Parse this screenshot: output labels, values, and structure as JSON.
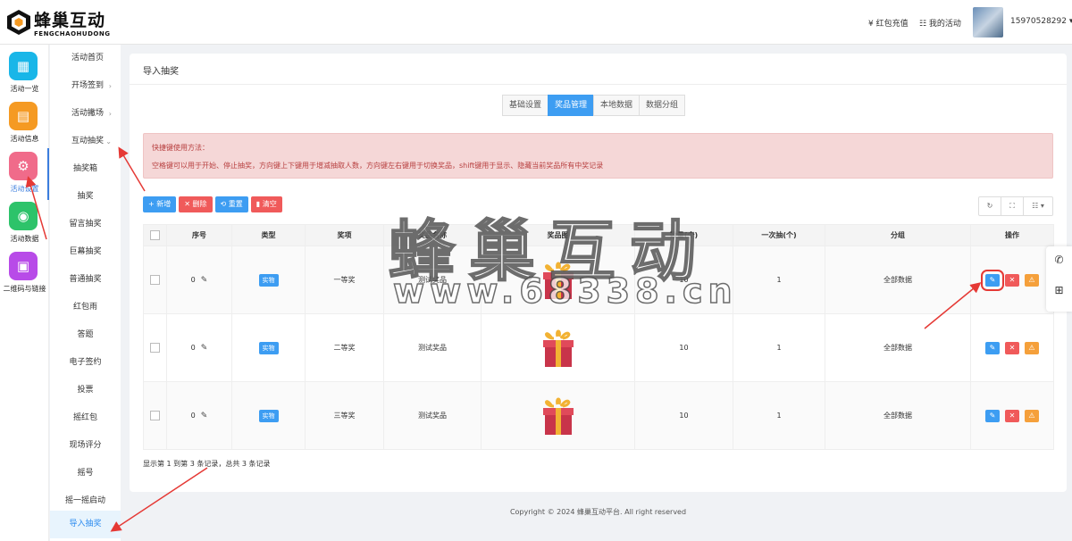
{
  "brand": {
    "name": "蜂巢互动",
    "sub": "FENGCHAOHUDONG"
  },
  "header": {
    "recharge": "¥ 红包充值",
    "my_activity": "☷ 我的活动",
    "user": "15970528292 ▾"
  },
  "iconbar": [
    {
      "label": "活动一览",
      "color": "#19b6e8"
    },
    {
      "label": "活动信息",
      "color": "#f59a23"
    },
    {
      "label": "活动设置",
      "color": "#f06b8a"
    },
    {
      "label": "活动数据",
      "color": "#2dc36a"
    },
    {
      "label": "二维码与链接",
      "color": "#b84be8"
    }
  ],
  "submenu": [
    {
      "label": "活动首页"
    },
    {
      "label": "开场签到",
      "chev": "›"
    },
    {
      "label": "活动撇场",
      "chev": "›"
    },
    {
      "label": "互动抽奖",
      "chev": "⌄"
    },
    {
      "label": "抽奖箱"
    },
    {
      "label": "抽奖"
    },
    {
      "label": "留言抽奖"
    },
    {
      "label": "巨幕抽奖"
    },
    {
      "label": "普通抽奖"
    },
    {
      "label": "红包雨"
    },
    {
      "label": "答题"
    },
    {
      "label": "电子签约"
    },
    {
      "label": "投票"
    },
    {
      "label": "摇红包"
    },
    {
      "label": "现场评分"
    },
    {
      "label": "摇号"
    },
    {
      "label": "摇一摇启动"
    },
    {
      "label": "导入抽奖"
    }
  ],
  "panel": {
    "title": "导入抽奖",
    "tabs": [
      "基础设置",
      "奖品管理",
      "本地数据",
      "数据分组"
    ],
    "tips_title": "快捷键使用方法：",
    "tips_body": "空格键可以用于开始、停止抽奖，方向键上下键用于增减抽取人数，方向键左右键用于切换奖品，shift键用于显示、隐藏当前奖品所有中奖记录",
    "toolbar": {
      "add": "+ 新增",
      "delete": "✕ 删除",
      "reset": "⟲ 重置",
      "clear": "▮ 清空"
    },
    "rtools": [
      "↻",
      "⛶",
      "☷ ▾"
    ],
    "columns": [
      "序号",
      "类型",
      "奖项",
      "奖品名称",
      "奖品图",
      "数量(个)",
      "一次抽(个)",
      "分组",
      "操作"
    ],
    "rows": [
      {
        "index": "0",
        "type": "实物",
        "level": "一等奖",
        "name": "测试奖品",
        "qty": "10",
        "once": "1",
        "group": "全部数据"
      },
      {
        "index": "0",
        "type": "实物",
        "level": "二等奖",
        "name": "测试奖品",
        "qty": "10",
        "once": "1",
        "group": "全部数据"
      },
      {
        "index": "0",
        "type": "实物",
        "level": "三等奖",
        "name": "测试奖品",
        "qty": "10",
        "once": "1",
        "group": "全部数据"
      }
    ],
    "page_info": "显示第 1 到第 3 条记录，总共 3 条记录"
  },
  "footer": "Copyright © 2024 蜂巢互动平台. All right reserved",
  "watermark": {
    "text": "蜂巢互动",
    "url": "www.68338.cn"
  }
}
